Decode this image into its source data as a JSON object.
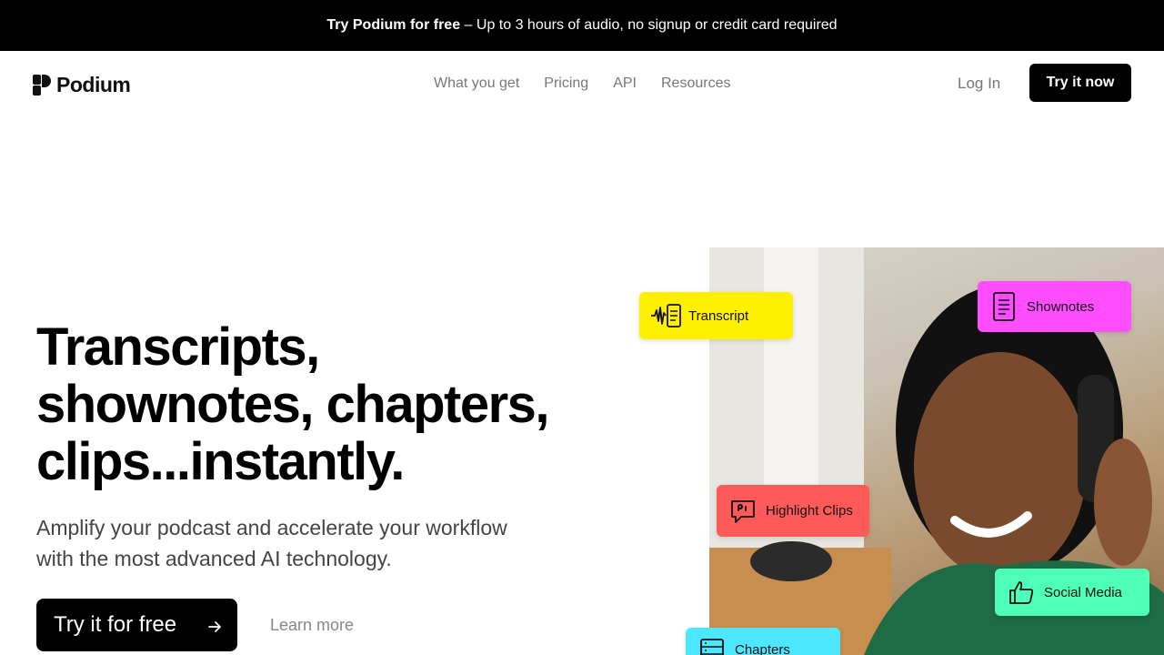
{
  "banner": {
    "bold": "Try Podium for free",
    "rest": " – Up to 3 hours of audio, no signup or credit card required"
  },
  "nav": {
    "logo": "Podium",
    "links": [
      "What you get",
      "Pricing",
      "API",
      "Resources"
    ],
    "login": "Log In",
    "cta": "Try it now"
  },
  "hero": {
    "headline_lines": [
      "Transcripts,",
      "shownotes, chapters,",
      "clips...instantly."
    ],
    "subhead_lines": [
      "Amplify your podcast and accelerate your workflow",
      "with the most advanced AI technology."
    ],
    "primary_cta": "Try it for free",
    "secondary_cta": "Learn more"
  },
  "tags": {
    "transcript": {
      "label": "Transcript",
      "color": "#fff000",
      "icon": "waveform-document-icon"
    },
    "shownotes": {
      "label": "Shownotes",
      "color": "#ff4dff",
      "icon": "document-icon"
    },
    "clips": {
      "label": "Highlight Clips",
      "color": "#ff5a5a",
      "icon": "quote-bubble-icon"
    },
    "social": {
      "label": "Social Media",
      "color": "#4dffb8",
      "icon": "thumbs-up-icon"
    },
    "chapters": {
      "label": "Chapters",
      "color": "#4de8ff",
      "icon": "chapters-list-icon"
    }
  },
  "colors": {
    "primary": "#000000",
    "muted": "#777777"
  }
}
